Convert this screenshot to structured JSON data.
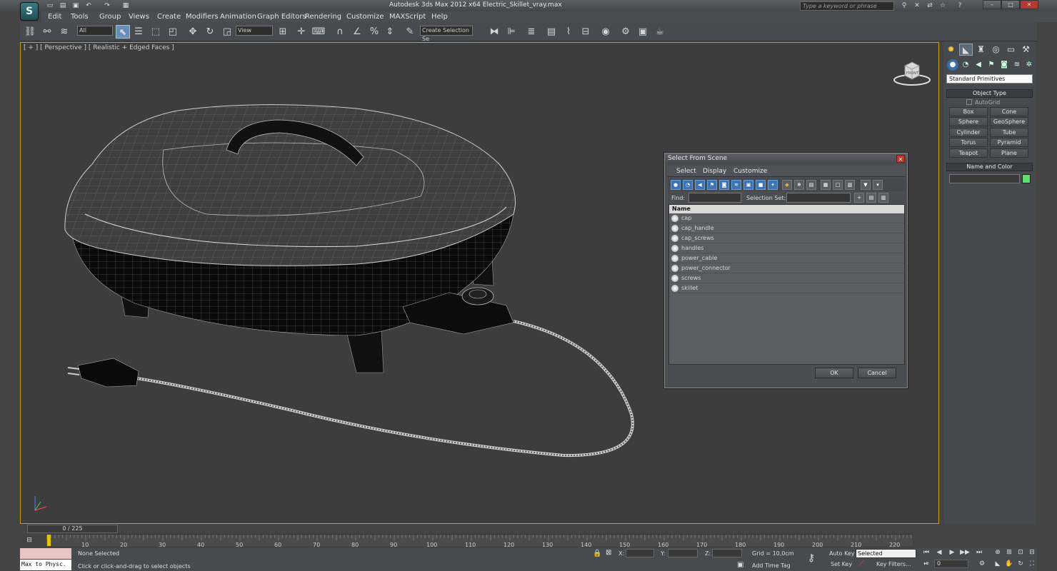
{
  "titlebar": {
    "title": "Autodesk 3ds Max  2012 x64      Electric_Skillet_vray.max",
    "search_placeholder": "Type a keyword or phrase"
  },
  "menu": [
    "Edit",
    "Tools",
    "Group",
    "Views",
    "Create",
    "Modifiers",
    "Animation",
    "Graph Editors",
    "Rendering",
    "Customize",
    "MAXScript",
    "Help"
  ],
  "toolbar": {
    "filter": "All",
    "ref_coord": "View",
    "selection_set": "Create Selection Se"
  },
  "viewport": {
    "label": "[ + ] [ Perspective ] [ Realistic + Edged Faces ]",
    "cube_label": "FRONT"
  },
  "command_panel": {
    "dropdown": "Standard Primitives",
    "object_type_title": "Object Type",
    "autogrid": "AutoGrid",
    "buttons": [
      "Box",
      "Cone",
      "Sphere",
      "GeoSphere",
      "Cylinder",
      "Tube",
      "Torus",
      "Pyramid",
      "Teapot",
      "Plane"
    ],
    "name_color_title": "Name and Color"
  },
  "dialog": {
    "title": "Select From Scene",
    "menus": [
      "Select",
      "Display",
      "Customize"
    ],
    "find_label": "Find:",
    "selection_set_label": "Selection Set:",
    "column": "Name",
    "objects": [
      "cap",
      "cap_handle",
      "cap_screws",
      "handles",
      "power_cable",
      "power_connector",
      "screws",
      "skillet"
    ],
    "ok": "OK",
    "cancel": "Cancel"
  },
  "timeline": {
    "slider": "0 / 225",
    "ticks": [
      "10",
      "20",
      "30",
      "40",
      "50",
      "60",
      "70",
      "80",
      "90",
      "100",
      "110",
      "120",
      "130",
      "140",
      "150",
      "160",
      "170",
      "180",
      "190",
      "200",
      "210",
      "220"
    ]
  },
  "status": {
    "maxscript": "Max to Physc.",
    "selected": "None Selected",
    "prompt": "Click or click-and-drag to select objects",
    "x": "X:",
    "y": "Y:",
    "z": "Z:",
    "grid": "Grid = 10,0cm",
    "add_time_tag": "Add Time Tag",
    "auto_key": "Auto Key",
    "set_key": "Set Key",
    "key_mode": "Selected",
    "key_filters": "Key Filters...",
    "frame": "0"
  }
}
